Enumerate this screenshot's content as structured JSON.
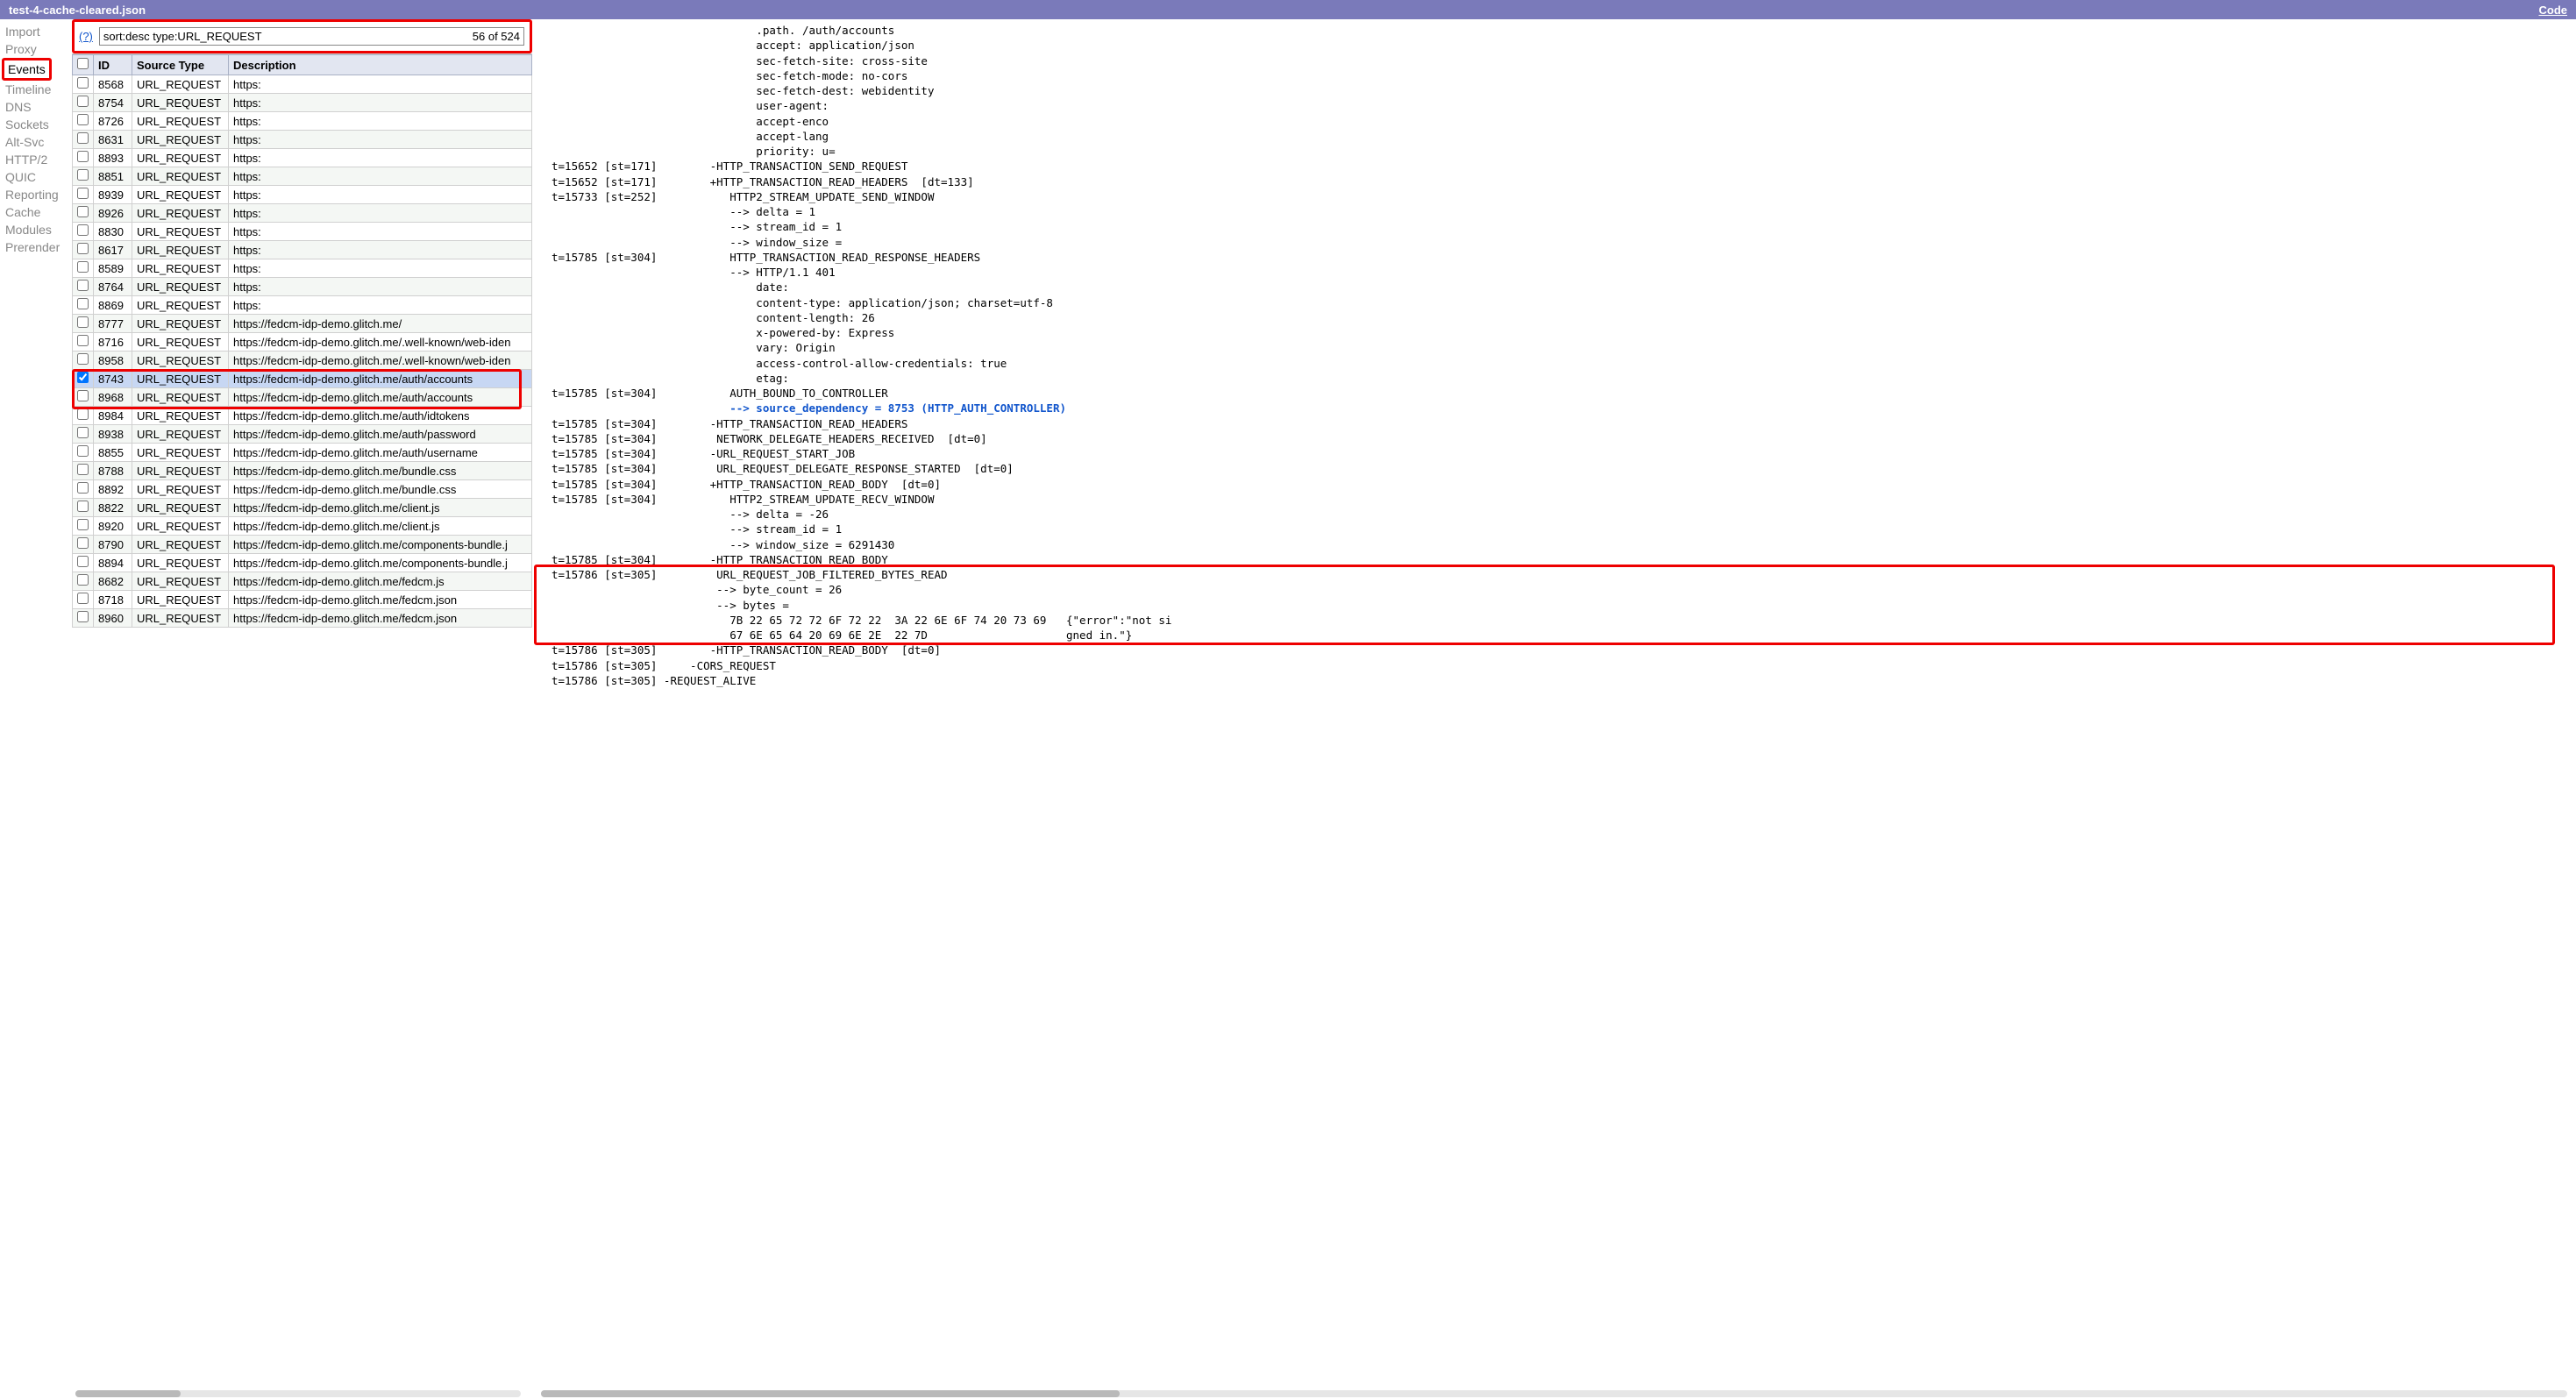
{
  "titlebar": {
    "filename": "test-4-cache-cleared.json",
    "code_link": "Code"
  },
  "sidebar": {
    "items": [
      {
        "label": "Import"
      },
      {
        "label": "Proxy"
      },
      {
        "label": "Events",
        "active": true
      },
      {
        "label": "Timeline"
      },
      {
        "label": "DNS"
      },
      {
        "label": "Sockets"
      },
      {
        "label": "Alt-Svc"
      },
      {
        "label": "HTTP/2"
      },
      {
        "label": "QUIC"
      },
      {
        "label": "Reporting"
      },
      {
        "label": "Cache"
      },
      {
        "label": "Modules"
      },
      {
        "label": "Prerender"
      }
    ]
  },
  "filter": {
    "help": "(?)",
    "value": "sort:desc type:URL_REQUEST",
    "count": "56 of 524"
  },
  "table": {
    "headers": [
      "",
      "ID",
      "Source Type",
      "Description"
    ],
    "rows": [
      {
        "id": "8568",
        "type": "URL_REQUEST",
        "desc": "https:"
      },
      {
        "id": "8754",
        "type": "URL_REQUEST",
        "desc": "https:"
      },
      {
        "id": "8726",
        "type": "URL_REQUEST",
        "desc": "https:"
      },
      {
        "id": "8631",
        "type": "URL_REQUEST",
        "desc": "https:"
      },
      {
        "id": "8893",
        "type": "URL_REQUEST",
        "desc": "https:"
      },
      {
        "id": "8851",
        "type": "URL_REQUEST",
        "desc": "https:"
      },
      {
        "id": "8939",
        "type": "URL_REQUEST",
        "desc": "https:"
      },
      {
        "id": "8926",
        "type": "URL_REQUEST",
        "desc": "https:"
      },
      {
        "id": "8830",
        "type": "URL_REQUEST",
        "desc": "https:"
      },
      {
        "id": "8617",
        "type": "URL_REQUEST",
        "desc": "https:"
      },
      {
        "id": "8589",
        "type": "URL_REQUEST",
        "desc": "https:"
      },
      {
        "id": "8764",
        "type": "URL_REQUEST",
        "desc": "https:"
      },
      {
        "id": "8869",
        "type": "URL_REQUEST",
        "desc": "https:"
      },
      {
        "id": "8777",
        "type": "URL_REQUEST",
        "desc": "https://fedcm-idp-demo.glitch.me/"
      },
      {
        "id": "8716",
        "type": "URL_REQUEST",
        "desc": "https://fedcm-idp-demo.glitch.me/.well-known/web-iden"
      },
      {
        "id": "8958",
        "type": "URL_REQUEST",
        "desc": "https://fedcm-idp-demo.glitch.me/.well-known/web-iden"
      },
      {
        "id": "8743",
        "type": "URL_REQUEST",
        "desc": "https://fedcm-idp-demo.glitch.me/auth/accounts",
        "checked": true,
        "selected": true
      },
      {
        "id": "8968",
        "type": "URL_REQUEST",
        "desc": "https://fedcm-idp-demo.glitch.me/auth/accounts"
      },
      {
        "id": "8984",
        "type": "URL_REQUEST",
        "desc": "https://fedcm-idp-demo.glitch.me/auth/idtokens"
      },
      {
        "id": "8938",
        "type": "URL_REQUEST",
        "desc": "https://fedcm-idp-demo.glitch.me/auth/password"
      },
      {
        "id": "8855",
        "type": "URL_REQUEST",
        "desc": "https://fedcm-idp-demo.glitch.me/auth/username"
      },
      {
        "id": "8788",
        "type": "URL_REQUEST",
        "desc": "https://fedcm-idp-demo.glitch.me/bundle.css"
      },
      {
        "id": "8892",
        "type": "URL_REQUEST",
        "desc": "https://fedcm-idp-demo.glitch.me/bundle.css"
      },
      {
        "id": "8822",
        "type": "URL_REQUEST",
        "desc": "https://fedcm-idp-demo.glitch.me/client.js"
      },
      {
        "id": "8920",
        "type": "URL_REQUEST",
        "desc": "https://fedcm-idp-demo.glitch.me/client.js"
      },
      {
        "id": "8790",
        "type": "URL_REQUEST",
        "desc": "https://fedcm-idp-demo.glitch.me/components-bundle.j"
      },
      {
        "id": "8894",
        "type": "URL_REQUEST",
        "desc": "https://fedcm-idp-demo.glitch.me/components-bundle.j"
      },
      {
        "id": "8682",
        "type": "URL_REQUEST",
        "desc": "https://fedcm-idp-demo.glitch.me/fedcm.js"
      },
      {
        "id": "8718",
        "type": "URL_REQUEST",
        "desc": "https://fedcm-idp-demo.glitch.me/fedcm.json"
      },
      {
        "id": "8960",
        "type": "URL_REQUEST",
        "desc": "https://fedcm-idp-demo.glitch.me/fedcm.json"
      }
    ]
  },
  "detail_lines": [
    "                               .path. /auth/accounts",
    "                               accept: application/json",
    "                               sec-fetch-site: cross-site",
    "                               sec-fetch-mode: no-cors",
    "                               sec-fetch-dest: webidentity",
    "                               user-agent:",
    "                               accept-enco",
    "                               accept-lang",
    "                               priority: u=",
    "t=15652 [st=171]        -HTTP_TRANSACTION_SEND_REQUEST",
    "t=15652 [st=171]        +HTTP_TRANSACTION_READ_HEADERS  [dt=133]",
    "t=15733 [st=252]           HTTP2_STREAM_UPDATE_SEND_WINDOW",
    "                           --> delta = 1",
    "                           --> stream_id = 1",
    "                           --> window_size =",
    "t=15785 [st=304]           HTTP_TRANSACTION_READ_RESPONSE_HEADERS",
    "                           --> HTTP/1.1 401",
    "                               date:",
    "                               content-type: application/json; charset=utf-8",
    "                               content-length: 26",
    "                               x-powered-by: Express",
    "                               vary: Origin",
    "                               access-control-allow-credentials: true",
    "                               etag:",
    "t=15785 [st=304]           AUTH_BOUND_TO_CONTROLLER",
    "                           --> source_dependency = 8753 (HTTP_AUTH_CONTROLLER)",
    "t=15785 [st=304]        -HTTP_TRANSACTION_READ_HEADERS",
    "t=15785 [st=304]         NETWORK_DELEGATE_HEADERS_RECEIVED  [dt=0]",
    "t=15785 [st=304]        -URL_REQUEST_START_JOB",
    "t=15785 [st=304]         URL_REQUEST_DELEGATE_RESPONSE_STARTED  [dt=0]",
    "t=15785 [st=304]        +HTTP_TRANSACTION_READ_BODY  [dt=0]",
    "t=15785 [st=304]           HTTP2_STREAM_UPDATE_RECV_WINDOW",
    "                           --> delta = -26",
    "                           --> stream_id = 1",
    "                           --> window_size = 6291430",
    "t=15785 [st=304]        -HTTP_TRANSACTION_READ_BODY",
    "t=15786 [st=305]         URL_REQUEST_JOB_FILTERED_BYTES_READ",
    "                         --> byte_count = 26",
    "                         --> bytes =",
    "                           7B 22 65 72 72 6F 72 22  3A 22 6E 6F 74 20 73 69   {\"error\":\"not si",
    "                           67 6E 65 64 20 69 6E 2E  22 7D                     gned in.\"}",
    "t=15786 [st=305]        -HTTP_TRANSACTION_READ_BODY  [dt=0]",
    "t=15786 [st=305]     -CORS_REQUEST",
    "t=15786 [st=305] -REQUEST_ALIVE"
  ]
}
